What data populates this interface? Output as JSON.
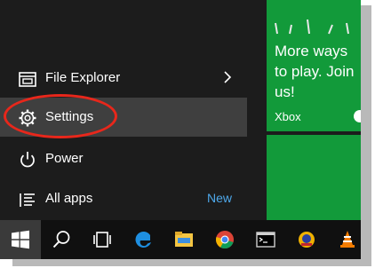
{
  "start_menu": {
    "items": [
      {
        "id": "file-explorer",
        "label": "File Explorer",
        "icon": "file-explorer-icon",
        "has_arrow": true
      },
      {
        "id": "settings",
        "label": "Settings",
        "icon": "gear-icon",
        "highlighted": true
      },
      {
        "id": "power",
        "label": "Power",
        "icon": "power-icon"
      },
      {
        "id": "all-apps",
        "label": "All apps",
        "icon": "all-apps-icon",
        "badge": "New"
      }
    ]
  },
  "tiles": {
    "xbox": {
      "text": "More ways\nto play. Join\nus!",
      "label": "Xbox"
    }
  },
  "taskbar": {
    "buttons": [
      "start-icon",
      "search-icon",
      "task-view-icon",
      "edge-icon",
      "file-explorer-icon",
      "chrome-icon",
      "terminal-icon",
      "app-icon",
      "vlc-icon"
    ]
  },
  "colors": {
    "tile_green": "#129a3a",
    "selected_item": "#3f3f3f",
    "accent_blue": "#4ea8ea",
    "annotation_red": "#e8271b"
  }
}
